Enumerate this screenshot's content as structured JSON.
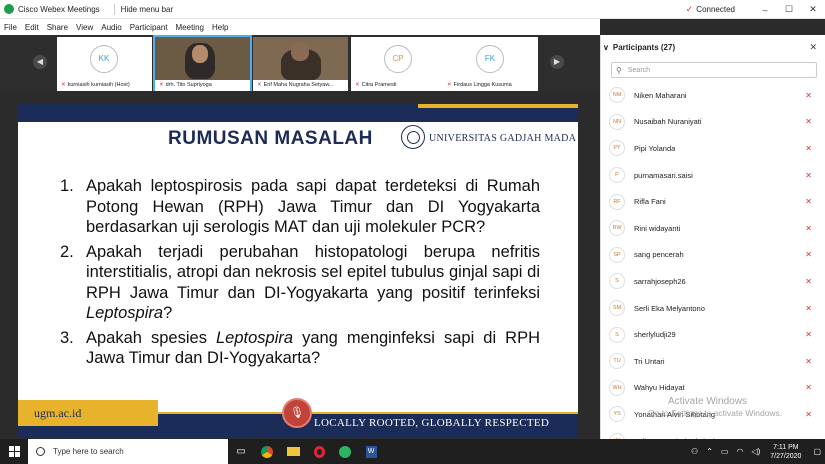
{
  "window": {
    "title": "Cisco Webex Meetings",
    "hide_menu": "Hide menu bar",
    "status": "Connected",
    "controls": [
      "–",
      "☐",
      "✕"
    ]
  },
  "menu": [
    "File",
    "Edit",
    "Share",
    "View",
    "Audio",
    "Participant",
    "Meeting",
    "Help"
  ],
  "strip": {
    "tiles": [
      {
        "initials": "KK",
        "name": "kurniasih kurniasih (Host)",
        "video": false
      },
      {
        "initials": "",
        "name": "drh. Tito Supriyoga",
        "video": true
      },
      {
        "initials": "",
        "name": "Erif Maha Nugraha Setyaw...",
        "video": true
      },
      {
        "initials": "CP",
        "name": "Citra Pramesti",
        "video": false
      },
      {
        "initials": "FK",
        "name": "Firdaus Lingga Kusuma",
        "video": false
      }
    ]
  },
  "slide": {
    "heading": "RUMUSAN MASALAH",
    "university": "UNIVERSITAS GADJAH MADA",
    "items": [
      {
        "num": "1.",
        "text": "Apakah leptospirosis pada sapi dapat terdeteksi di Rumah Potong Hewan (RPH) Jawa Timur dan DI Yogyakarta berdasarkan uji serologis MAT dan uji molekuler PCR?"
      },
      {
        "num": "2.",
        "text_a": "Apakah terjadi perubahan histopatologi berupa nefritis interstitialis, atropi dan nekrosis sel epitel tubulus ginjal sapi di RPH Jawa Timur dan DI-Yogyakarta yang positif terinfeksi ",
        "italic": "Leptospira",
        "text_b": "?"
      },
      {
        "num": "3.",
        "text_a": "Apakah spesies ",
        "italic": "Leptospira",
        "text_b": " yang menginfeksi sapi di RPH Jawa Timur dan  DI-Yogyakarta?"
      }
    ],
    "url": "ugm.ac.id",
    "tagline": "LOCALLY ROOTED, GLOBALLY RESPECTED"
  },
  "panel": {
    "title": "Participants (27)",
    "search_placeholder": "Search",
    "participants": [
      {
        "initials": "NM",
        "name": "Niken Maharani"
      },
      {
        "initials": "NN",
        "name": "Nusaibah Nuraniyati"
      },
      {
        "initials": "PY",
        "name": "Pipi Yolanda"
      },
      {
        "initials": "P",
        "name": "purnamasari.saisi"
      },
      {
        "initials": "RF",
        "name": "Rifla Fani"
      },
      {
        "initials": "RW",
        "name": "Rini widayanti"
      },
      {
        "initials": "SP",
        "name": "sang pencerah"
      },
      {
        "initials": "S",
        "name": "sarrahjoseph26"
      },
      {
        "initials": "SM",
        "name": "Serli Eka Melyantono"
      },
      {
        "initials": "S",
        "name": "sherlyludji29"
      },
      {
        "initials": "TU",
        "name": "Tri Untari"
      },
      {
        "initials": "WH",
        "name": "Wahyu Hidayat"
      },
      {
        "initials": "YS",
        "name": "Yonathan Alvin Sihotang"
      },
      {
        "initials": "YK",
        "name": "Yuli Purwandari Kristianingrum"
      }
    ]
  },
  "watermark": {
    "line1": "Activate Windows",
    "line2": "Go to Settings to activate Windows."
  },
  "taskbar": {
    "search_placeholder": "Type here to search",
    "time": "7:11 PM",
    "date": "7/27/2020"
  }
}
